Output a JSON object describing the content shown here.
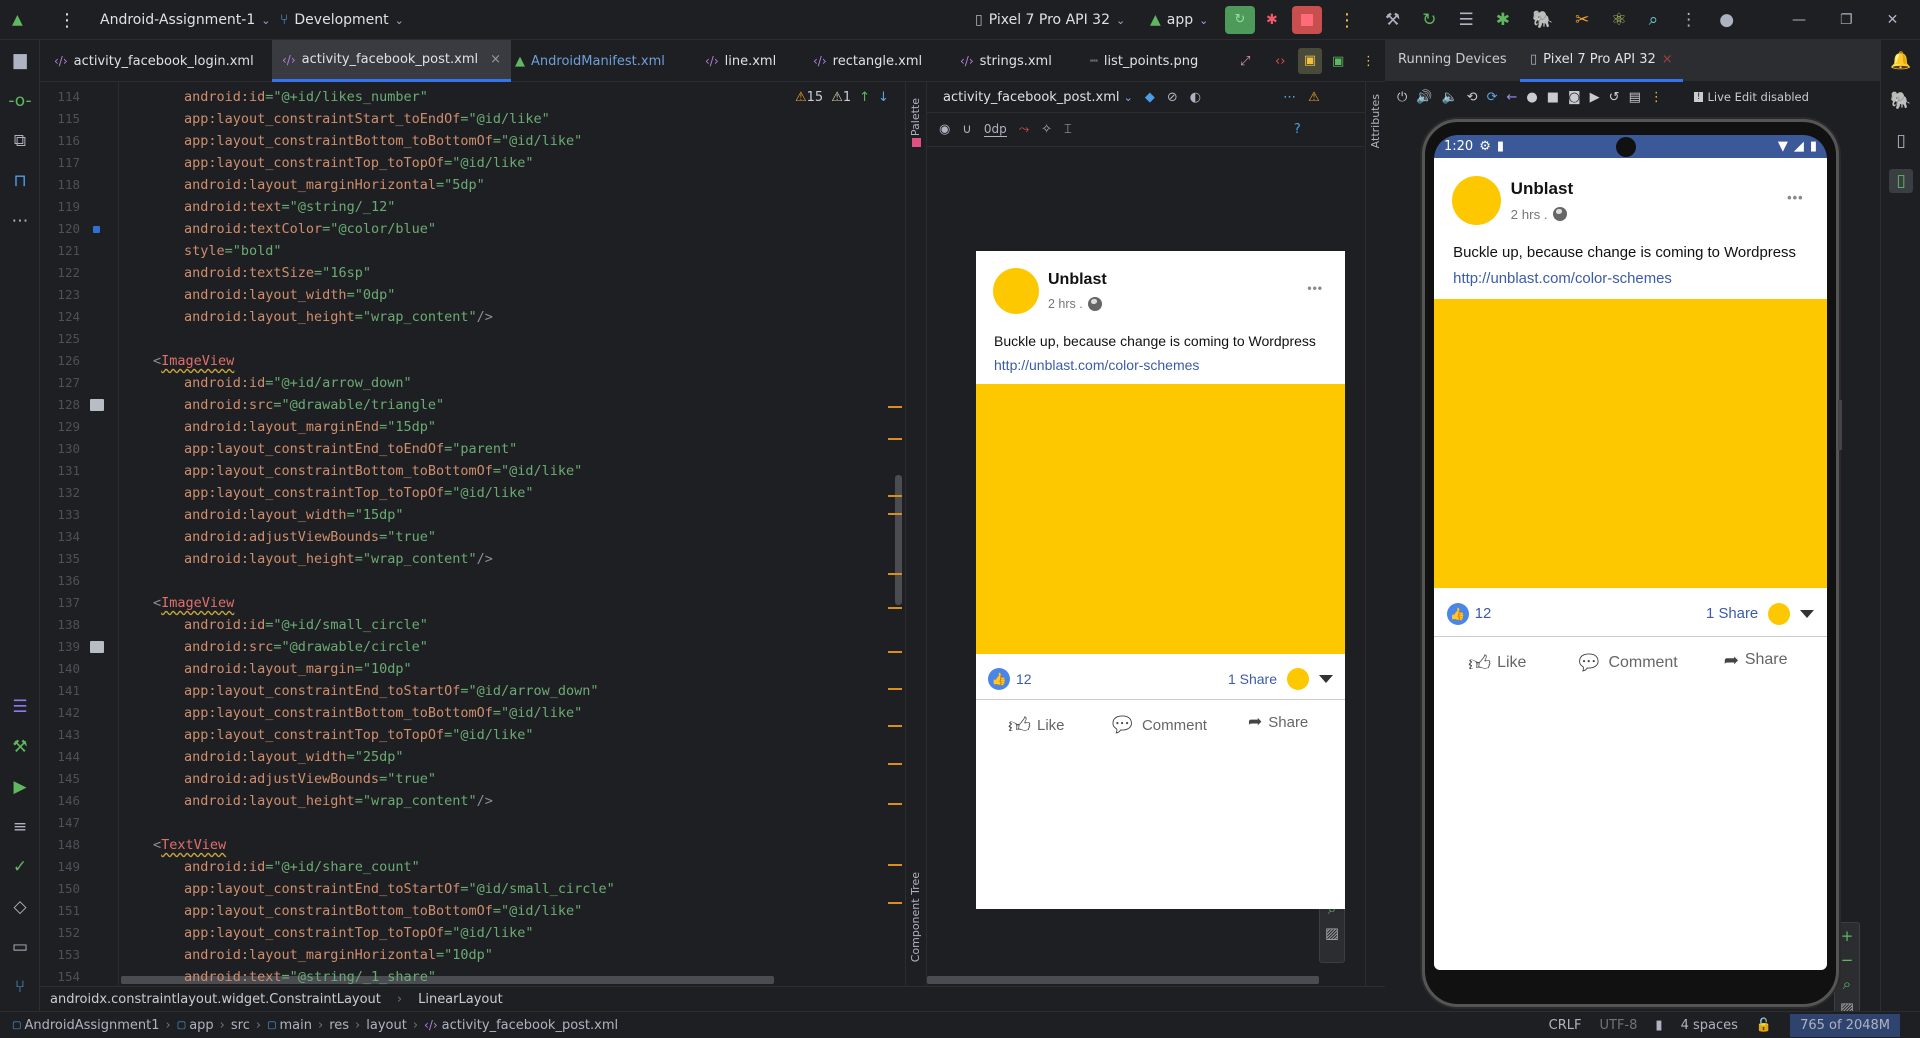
{
  "topbar": {
    "project": "Android-Assignment-1",
    "branch": "Development",
    "device": "Pixel 7 Pro API 32",
    "run_config": "app"
  },
  "tabs": [
    {
      "label": "activity_facebook_login.xml",
      "icon": "xml-icon"
    },
    {
      "label": "activity_facebook_post.xml",
      "icon": "xml-icon",
      "active": true
    },
    {
      "label": "AndroidManifest.xml",
      "icon": "android-icon"
    },
    {
      "label": "line.xml",
      "icon": "xml-icon"
    },
    {
      "label": "rectangle.xml",
      "icon": "xml-icon"
    },
    {
      "label": "strings.xml",
      "icon": "xml-icon"
    },
    {
      "label": "list_points.png",
      "icon": "image-icon"
    }
  ],
  "editor": {
    "warnings": "15",
    "weak_warnings": "1",
    "lines": [
      {
        "n": "114",
        "a": "android:id",
        "v": "@+id/likes_number"
      },
      {
        "n": "115",
        "a": "app:layout_constraintStart_toEndOf",
        "v": "@id/like"
      },
      {
        "n": "116",
        "a": "app:layout_constraintBottom_toBottomOf",
        "v": "@id/like"
      },
      {
        "n": "117",
        "a": "app:layout_constraintTop_toTopOf",
        "v": "@id/like"
      },
      {
        "n": "118",
        "a": "android:layout_marginHorizontal",
        "v": "5dp"
      },
      {
        "n": "119",
        "a": "android:text",
        "v": "@string/_12"
      },
      {
        "n": "120",
        "a": "android:textColor",
        "v": "@color/blue",
        "gi": "color"
      },
      {
        "n": "121",
        "a": "style",
        "v": "bold"
      },
      {
        "n": "122",
        "a": "android:textSize",
        "v": "16sp"
      },
      {
        "n": "123",
        "a": "android:layout_width",
        "v": "0dp"
      },
      {
        "n": "124",
        "a": "android:layout_height",
        "v": "wrap_content",
        "end": "/>"
      },
      {
        "n": "125"
      },
      {
        "n": "126",
        "t": "ImageView"
      },
      {
        "n": "127",
        "a": "android:id",
        "v": "@+id/arrow_down"
      },
      {
        "n": "128",
        "a": "android:src",
        "v": "@drawable/triangle",
        "gi": "image"
      },
      {
        "n": "129",
        "a": "android:layout_marginEnd",
        "v": "15dp"
      },
      {
        "n": "130",
        "a": "app:layout_constraintEnd_toEndOf",
        "v": "parent"
      },
      {
        "n": "131",
        "a": "app:layout_constraintBottom_toBottomOf",
        "v": "@id/like"
      },
      {
        "n": "132",
        "a": "app:layout_constraintTop_toTopOf",
        "v": "@id/like"
      },
      {
        "n": "133",
        "a": "android:layout_width",
        "v": "15dp"
      },
      {
        "n": "134",
        "a": "android:adjustViewBounds",
        "v": "true"
      },
      {
        "n": "135",
        "a": "android:layout_height",
        "v": "wrap_content",
        "end": "/>"
      },
      {
        "n": "136"
      },
      {
        "n": "137",
        "t": "ImageView"
      },
      {
        "n": "138",
        "a": "android:id",
        "v": "@+id/small_circle"
      },
      {
        "n": "139",
        "a": "android:src",
        "v": "@drawable/circle",
        "gi": "image"
      },
      {
        "n": "140",
        "a": "android:layout_margin",
        "v": "10dp"
      },
      {
        "n": "141",
        "a": "app:layout_constraintEnd_toStartOf",
        "v": "@id/arrow_down"
      },
      {
        "n": "142",
        "a": "app:layout_constraintBottom_toBottomOf",
        "v": "@id/like"
      },
      {
        "n": "143",
        "a": "app:layout_constraintTop_toTopOf",
        "v": "@id/like"
      },
      {
        "n": "144",
        "a": "android:layout_width",
        "v": "25dp"
      },
      {
        "n": "145",
        "a": "android:adjustViewBounds",
        "v": "true"
      },
      {
        "n": "146",
        "a": "android:layout_height",
        "v": "wrap_content",
        "end": "/>"
      },
      {
        "n": "147"
      },
      {
        "n": "148",
        "t": "TextView"
      },
      {
        "n": "149",
        "a": "android:id",
        "v": "@+id/share_count"
      },
      {
        "n": "150",
        "a": "app:layout_constraintEnd_toStartOf",
        "v": "@id/small_circle"
      },
      {
        "n": "151",
        "a": "app:layout_constraintBottom_toBottomOf",
        "v": "@id/like"
      },
      {
        "n": "152",
        "a": "app:layout_constraintTop_toTopOf",
        "v": "@id/like"
      },
      {
        "n": "153",
        "a": "android:layout_marginHorizontal",
        "v": "10dp"
      },
      {
        "n": "154",
        "a": "android:text",
        "v": "@string/_1_share"
      }
    ]
  },
  "design": {
    "file": "activity_facebook_post.xml",
    "margin": "0dp",
    "palette_label": "Palette",
    "tree_label": "Component Tree",
    "attributes_label": "Attributes"
  },
  "post": {
    "name": "Unblast",
    "time": "2 hrs .",
    "text": "Buckle up, because change is coming to Wordpress",
    "link": "http://unblast.com/color-schemes",
    "likes": "12",
    "shares": "1 Share",
    "like": "Like",
    "comment": "Comment",
    "share": "Share",
    "more": "•••",
    "image_color": "#fdc800",
    "accent": "#3b5998"
  },
  "running": {
    "title": "Running Devices",
    "device_tab": "Pixel 7 Pro API 32",
    "live_edit": "Live Edit disabled",
    "clock": "1:20"
  },
  "breadcrumb": [
    "androidx.constraintlayout.widget.ConstraintLayout",
    "LinearLayout"
  ],
  "status": {
    "path": [
      "AndroidAssignment1",
      "app",
      "src",
      "main",
      "res",
      "layout",
      "activity_facebook_post.xml"
    ],
    "line_sep": "CRLF",
    "encoding": "UTF-8",
    "indent": "4 spaces",
    "memory": "765 of 2048M"
  }
}
